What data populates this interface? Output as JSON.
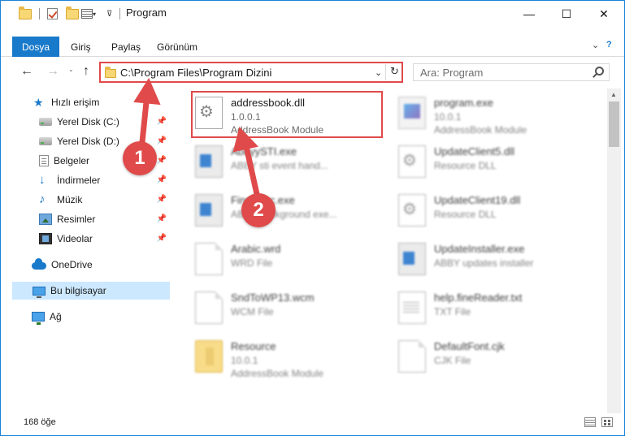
{
  "window": {
    "title": "Program",
    "minimize": "—",
    "maximize": "☐",
    "close": "✕"
  },
  "ribbon": {
    "file_tab": "Dosya",
    "tabs": [
      "Giriş",
      "Paylaş",
      "Görünüm"
    ],
    "collapse": "⌄",
    "help": "?"
  },
  "address": {
    "path": "C:\\Program Files\\Program Dizini",
    "refresh": "↻",
    "dropdown": "⌄"
  },
  "search": {
    "placeholder": "Ara: Program"
  },
  "nav": {
    "back": "←",
    "forward": "→",
    "up": "↑",
    "recent": "⌄"
  },
  "sidebar": {
    "items": [
      {
        "label": "Hızlı erişim",
        "icon": "star-icon"
      },
      {
        "label": "Yerel Disk (C:)",
        "icon": "drive-icon",
        "pinned": true
      },
      {
        "label": "Yerel Disk (D:)",
        "icon": "drive-icon",
        "pinned": true
      },
      {
        "label": "Belgeler",
        "icon": "documents-icon",
        "pinned": true
      },
      {
        "label": "İndirmeler",
        "icon": "download-icon",
        "pinned": true
      },
      {
        "label": "Müzik",
        "icon": "music-icon",
        "pinned": true
      },
      {
        "label": "Resimler",
        "icon": "pictures-icon",
        "pinned": true
      },
      {
        "label": "Videolar",
        "icon": "videos-icon",
        "pinned": true
      },
      {
        "label": "OneDrive",
        "icon": "onedrive-icon"
      },
      {
        "label": "Bu bilgisayar",
        "icon": "this-pc-icon",
        "selected": true
      },
      {
        "label": "Ağ",
        "icon": "network-icon"
      }
    ],
    "pin_glyph": "📌"
  },
  "files": {
    "items": [
      {
        "name": "addressbook.dll",
        "line1": "1.0.0.1",
        "line2": "AddressBook Module",
        "icon": "dll-gear-icon"
      },
      {
        "name": "program.exe",
        "line1": "10.0.1",
        "line2": "AddressBook Module",
        "icon": "program-exe-icon"
      },
      {
        "name": "AbbyySTI.exe",
        "line1": "ABBY sti event hand...",
        "line2": "",
        "icon": "exe-icon"
      },
      {
        "name": "UpdateClient5.dll",
        "line1": "Resource DLL",
        "line2": "",
        "icon": "dll-icon"
      },
      {
        "name": "FineExec.exe",
        "line1": "ABBY background exe...",
        "line2": "",
        "icon": "exe-icon"
      },
      {
        "name": "UpdateClient19.dll",
        "line1": "Resource DLL",
        "line2": "",
        "icon": "dll-icon"
      },
      {
        "name": "Arabic.wrd",
        "line1": "WRD File",
        "line2": "",
        "icon": "file-icon"
      },
      {
        "name": "UpdateInstaller.exe",
        "line1": "ABBY updates installer",
        "line2": "",
        "icon": "exe-icon"
      },
      {
        "name": "SndToWP13.wcm",
        "line1": "WCM File",
        "line2": "",
        "icon": "file-icon"
      },
      {
        "name": "help.fineReader.txt",
        "line1": "TXT File",
        "line2": "",
        "icon": "text-file-icon"
      },
      {
        "name": "Resource",
        "line1": "10.0.1",
        "line2": "AddressBook Module",
        "icon": "folder-icon"
      },
      {
        "name": "DefaultFont.cjk",
        "line1": "CJK File",
        "line2": "",
        "icon": "file-icon"
      }
    ]
  },
  "status": {
    "count": "168 öğe"
  },
  "annotations": {
    "step1": "1",
    "step2": "2",
    "color": "#e04a4a"
  },
  "colors": {
    "accent": "#1979ca",
    "selected_bg": "#cce8ff",
    "highlight": "#e04a4a"
  }
}
